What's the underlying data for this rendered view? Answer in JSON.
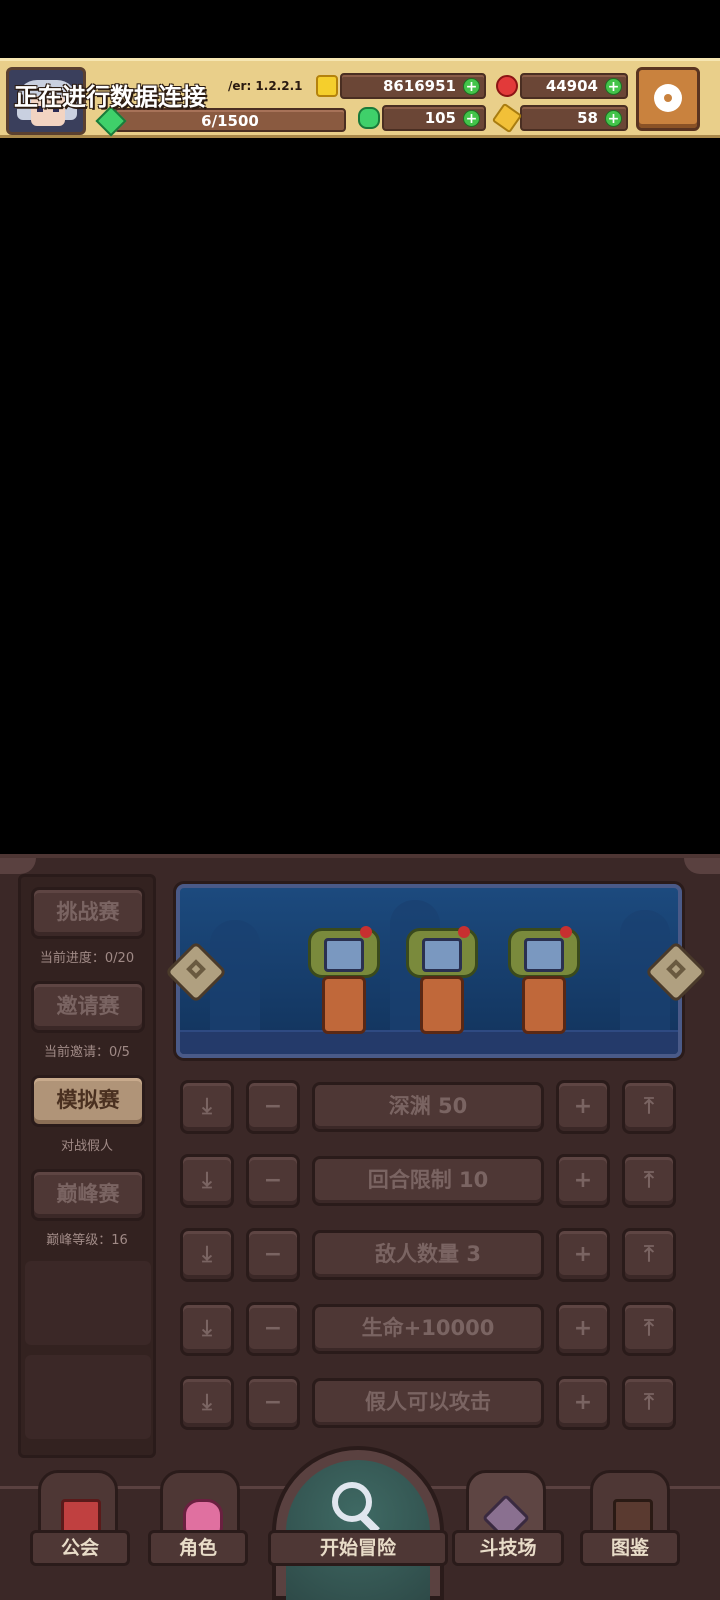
{
  "hud": {
    "status_text": "正在进行数据连接",
    "version_text": "/er: 1.2.2.1",
    "energy": "6/1500",
    "gold": "8616951",
    "ruby": "44904",
    "clover": "105",
    "key": "58",
    "plus": "+"
  },
  "modes": [
    {
      "label": "挑战赛",
      "sub": "当前进度：0/20"
    },
    {
      "label": "邀请赛",
      "sub": "当前邀请：0/5"
    },
    {
      "label": "模拟赛",
      "sub": "对战假人"
    },
    {
      "label": "巅峰赛",
      "sub": "巅峰等级：16"
    }
  ],
  "settings_rows": [
    {
      "value": "深渊 50"
    },
    {
      "value": "回合限制 10"
    },
    {
      "value": "敌人数量 3"
    },
    {
      "value": "生命+10000"
    },
    {
      "value": "假人可以攻击"
    }
  ],
  "row_glyphs": {
    "min": "⤓",
    "dec": "−",
    "inc": "+",
    "max": "⤒"
  },
  "nav": {
    "guild": "公会",
    "character": "角色",
    "start": "开始冒险",
    "arena": "斗技场",
    "codex": "图鉴"
  },
  "colors": {
    "hud_bg": "#e9cf8a",
    "panel_bg": "#3b2827",
    "active_mode": "#b09478",
    "preview_bg": "#1c4a7e"
  }
}
